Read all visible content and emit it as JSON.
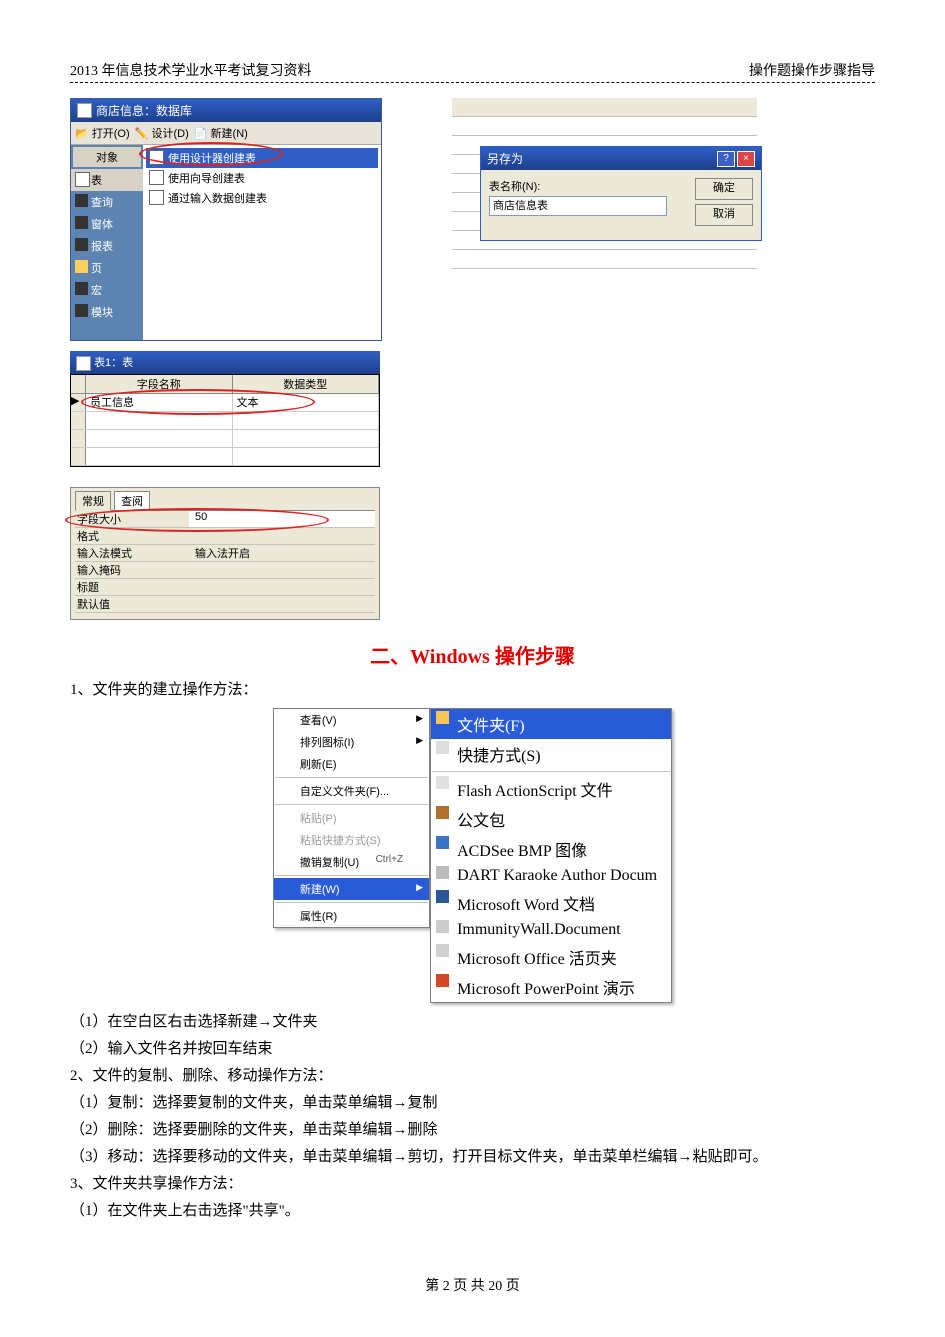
{
  "header": {
    "left": "2013 年信息技术学业水平考试复习资料",
    "right": "操作题操作步骤指导"
  },
  "access_db": {
    "title": "商店信息：数据库",
    "toolbar": {
      "open": "打开(O)",
      "design": "设计(D)",
      "new": "新建(N)"
    },
    "sidebar": {
      "header": "对象",
      "items": [
        "表",
        "查询",
        "窗体",
        "报表",
        "页",
        "宏",
        "模块"
      ]
    },
    "main_items": [
      "使用设计器创建表",
      "使用向导创建表",
      "通过输入数据创建表"
    ]
  },
  "saveas": {
    "title": "另存为",
    "name_label": "表名称(N):",
    "name_value": "商店信息表",
    "ok": "确定",
    "cancel": "取消"
  },
  "table_design": {
    "title": "表1：表",
    "col1": "字段名称",
    "col2": "数据类型",
    "row_name": "员工信息",
    "row_type": "文本"
  },
  "props": {
    "tab_general": "常规",
    "tab_lookup": "查阅",
    "rows": [
      {
        "label": "字段大小",
        "value": "50"
      },
      {
        "label": "格式",
        "value": ""
      },
      {
        "label": "输入法模式",
        "value": "输入法开启"
      },
      {
        "label": "输入掩码",
        "value": ""
      },
      {
        "label": "标题",
        "value": ""
      },
      {
        "label": "默认值",
        "value": ""
      }
    ]
  },
  "section_title": "二、Windows 操作步骤",
  "text": {
    "p1": "1、文件夹的建立操作方法：",
    "p2": "（1）在空白区右击选择新建→文件夹",
    "p3": "（2）输入文件名并按回车结束",
    "p4": "2、文件的复制、删除、移动操作方法：",
    "p5": "（1）复制：选择要复制的文件夹，单击菜单编辑→复制",
    "p6": "（2）删除：选择要删除的文件夹，单击菜单编辑→删除",
    "p7": "（3）移动：选择要移动的文件夹，单击菜单编辑→剪切，打开目标文件夹，单击菜单栏编辑→粘贴即可。",
    "p8": "3、文件夹共享操作方法：",
    "p9": "（1）在文件夹上右击选择\"共享\"。"
  },
  "ctx_menu": {
    "items": [
      {
        "label": "查看(V)",
        "arrow": true
      },
      {
        "label": "排列图标(I)",
        "arrow": true
      },
      {
        "label": "刷新(E)"
      },
      {
        "sep": true
      },
      {
        "label": "自定义文件夹(F)..."
      },
      {
        "sep": true
      },
      {
        "label": "粘贴(P)",
        "disabled": true
      },
      {
        "label": "粘贴快捷方式(S)",
        "disabled": true
      },
      {
        "label": "撤销复制(U)",
        "shortcut": "Ctrl+Z"
      },
      {
        "sep": true
      },
      {
        "label": "新建(W)",
        "arrow": true,
        "selected": true
      },
      {
        "sep": true
      },
      {
        "label": "属性(R)"
      }
    ],
    "submenu": [
      {
        "label": "文件夹(F)",
        "selected": true,
        "icon": "#f6c758"
      },
      {
        "label": "快捷方式(S)",
        "icon": "#dddddd"
      },
      {
        "sep": true
      },
      {
        "label": "Flash ActionScript 文件",
        "icon": "#e0e0e0"
      },
      {
        "label": "公文包",
        "icon": "#b07030"
      },
      {
        "label": "ACDSee BMP 图像",
        "icon": "#3a74c4"
      },
      {
        "label": "DART Karaoke Author Docum",
        "icon": "#bbbbbb"
      },
      {
        "label": "Microsoft Word 文档",
        "icon": "#2b579a"
      },
      {
        "label": "ImmunityWall.Document",
        "icon": "#cccccc"
      },
      {
        "label": "Microsoft Office 活页夹",
        "icon": "#d0d0d0"
      },
      {
        "label": "Microsoft PowerPoint 演示",
        "icon": "#d24726"
      }
    ]
  },
  "footer": "第 2 页 共 20 页"
}
